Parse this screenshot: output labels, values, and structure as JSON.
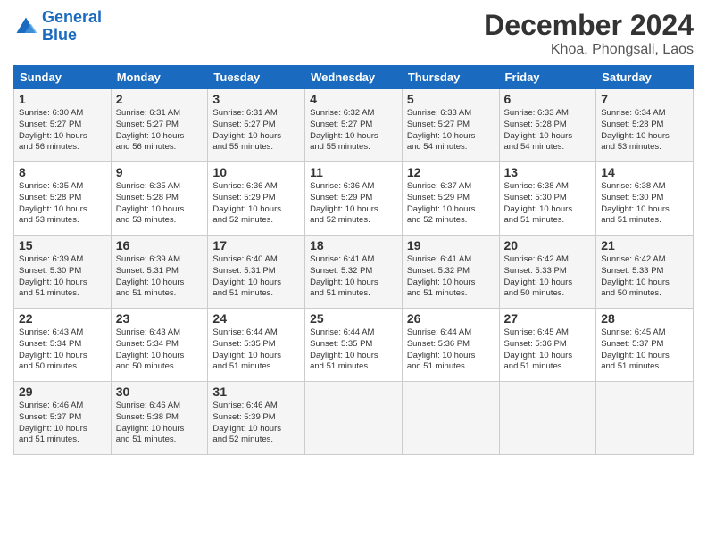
{
  "header": {
    "logo_line1": "General",
    "logo_line2": "Blue",
    "month_year": "December 2024",
    "location": "Khoa, Phongsali, Laos"
  },
  "days_of_week": [
    "Sunday",
    "Monday",
    "Tuesday",
    "Wednesday",
    "Thursday",
    "Friday",
    "Saturday"
  ],
  "weeks": [
    [
      {
        "day": "1",
        "lines": [
          "Sunrise: 6:30 AM",
          "Sunset: 5:27 PM",
          "Daylight: 10 hours",
          "and 56 minutes."
        ]
      },
      {
        "day": "2",
        "lines": [
          "Sunrise: 6:31 AM",
          "Sunset: 5:27 PM",
          "Daylight: 10 hours",
          "and 56 minutes."
        ]
      },
      {
        "day": "3",
        "lines": [
          "Sunrise: 6:31 AM",
          "Sunset: 5:27 PM",
          "Daylight: 10 hours",
          "and 55 minutes."
        ]
      },
      {
        "day": "4",
        "lines": [
          "Sunrise: 6:32 AM",
          "Sunset: 5:27 PM",
          "Daylight: 10 hours",
          "and 55 minutes."
        ]
      },
      {
        "day": "5",
        "lines": [
          "Sunrise: 6:33 AM",
          "Sunset: 5:27 PM",
          "Daylight: 10 hours",
          "and 54 minutes."
        ]
      },
      {
        "day": "6",
        "lines": [
          "Sunrise: 6:33 AM",
          "Sunset: 5:28 PM",
          "Daylight: 10 hours",
          "and 54 minutes."
        ]
      },
      {
        "day": "7",
        "lines": [
          "Sunrise: 6:34 AM",
          "Sunset: 5:28 PM",
          "Daylight: 10 hours",
          "and 53 minutes."
        ]
      }
    ],
    [
      {
        "day": "8",
        "lines": [
          "Sunrise: 6:35 AM",
          "Sunset: 5:28 PM",
          "Daylight: 10 hours",
          "and 53 minutes."
        ]
      },
      {
        "day": "9",
        "lines": [
          "Sunrise: 6:35 AM",
          "Sunset: 5:28 PM",
          "Daylight: 10 hours",
          "and 53 minutes."
        ]
      },
      {
        "day": "10",
        "lines": [
          "Sunrise: 6:36 AM",
          "Sunset: 5:29 PM",
          "Daylight: 10 hours",
          "and 52 minutes."
        ]
      },
      {
        "day": "11",
        "lines": [
          "Sunrise: 6:36 AM",
          "Sunset: 5:29 PM",
          "Daylight: 10 hours",
          "and 52 minutes."
        ]
      },
      {
        "day": "12",
        "lines": [
          "Sunrise: 6:37 AM",
          "Sunset: 5:29 PM",
          "Daylight: 10 hours",
          "and 52 minutes."
        ]
      },
      {
        "day": "13",
        "lines": [
          "Sunrise: 6:38 AM",
          "Sunset: 5:30 PM",
          "Daylight: 10 hours",
          "and 51 minutes."
        ]
      },
      {
        "day": "14",
        "lines": [
          "Sunrise: 6:38 AM",
          "Sunset: 5:30 PM",
          "Daylight: 10 hours",
          "and 51 minutes."
        ]
      }
    ],
    [
      {
        "day": "15",
        "lines": [
          "Sunrise: 6:39 AM",
          "Sunset: 5:30 PM",
          "Daylight: 10 hours",
          "and 51 minutes."
        ]
      },
      {
        "day": "16",
        "lines": [
          "Sunrise: 6:39 AM",
          "Sunset: 5:31 PM",
          "Daylight: 10 hours",
          "and 51 minutes."
        ]
      },
      {
        "day": "17",
        "lines": [
          "Sunrise: 6:40 AM",
          "Sunset: 5:31 PM",
          "Daylight: 10 hours",
          "and 51 minutes."
        ]
      },
      {
        "day": "18",
        "lines": [
          "Sunrise: 6:41 AM",
          "Sunset: 5:32 PM",
          "Daylight: 10 hours",
          "and 51 minutes."
        ]
      },
      {
        "day": "19",
        "lines": [
          "Sunrise: 6:41 AM",
          "Sunset: 5:32 PM",
          "Daylight: 10 hours",
          "and 51 minutes."
        ]
      },
      {
        "day": "20",
        "lines": [
          "Sunrise: 6:42 AM",
          "Sunset: 5:33 PM",
          "Daylight: 10 hours",
          "and 50 minutes."
        ]
      },
      {
        "day": "21",
        "lines": [
          "Sunrise: 6:42 AM",
          "Sunset: 5:33 PM",
          "Daylight: 10 hours",
          "and 50 minutes."
        ]
      }
    ],
    [
      {
        "day": "22",
        "lines": [
          "Sunrise: 6:43 AM",
          "Sunset: 5:34 PM",
          "Daylight: 10 hours",
          "and 50 minutes."
        ]
      },
      {
        "day": "23",
        "lines": [
          "Sunrise: 6:43 AM",
          "Sunset: 5:34 PM",
          "Daylight: 10 hours",
          "and 50 minutes."
        ]
      },
      {
        "day": "24",
        "lines": [
          "Sunrise: 6:44 AM",
          "Sunset: 5:35 PM",
          "Daylight: 10 hours",
          "and 51 minutes."
        ]
      },
      {
        "day": "25",
        "lines": [
          "Sunrise: 6:44 AM",
          "Sunset: 5:35 PM",
          "Daylight: 10 hours",
          "and 51 minutes."
        ]
      },
      {
        "day": "26",
        "lines": [
          "Sunrise: 6:44 AM",
          "Sunset: 5:36 PM",
          "Daylight: 10 hours",
          "and 51 minutes."
        ]
      },
      {
        "day": "27",
        "lines": [
          "Sunrise: 6:45 AM",
          "Sunset: 5:36 PM",
          "Daylight: 10 hours",
          "and 51 minutes."
        ]
      },
      {
        "day": "28",
        "lines": [
          "Sunrise: 6:45 AM",
          "Sunset: 5:37 PM",
          "Daylight: 10 hours",
          "and 51 minutes."
        ]
      }
    ],
    [
      {
        "day": "29",
        "lines": [
          "Sunrise: 6:46 AM",
          "Sunset: 5:37 PM",
          "Daylight: 10 hours",
          "and 51 minutes."
        ]
      },
      {
        "day": "30",
        "lines": [
          "Sunrise: 6:46 AM",
          "Sunset: 5:38 PM",
          "Daylight: 10 hours",
          "and 51 minutes."
        ]
      },
      {
        "day": "31",
        "lines": [
          "Sunrise: 6:46 AM",
          "Sunset: 5:39 PM",
          "Daylight: 10 hours",
          "and 52 minutes."
        ]
      },
      null,
      null,
      null,
      null
    ]
  ]
}
